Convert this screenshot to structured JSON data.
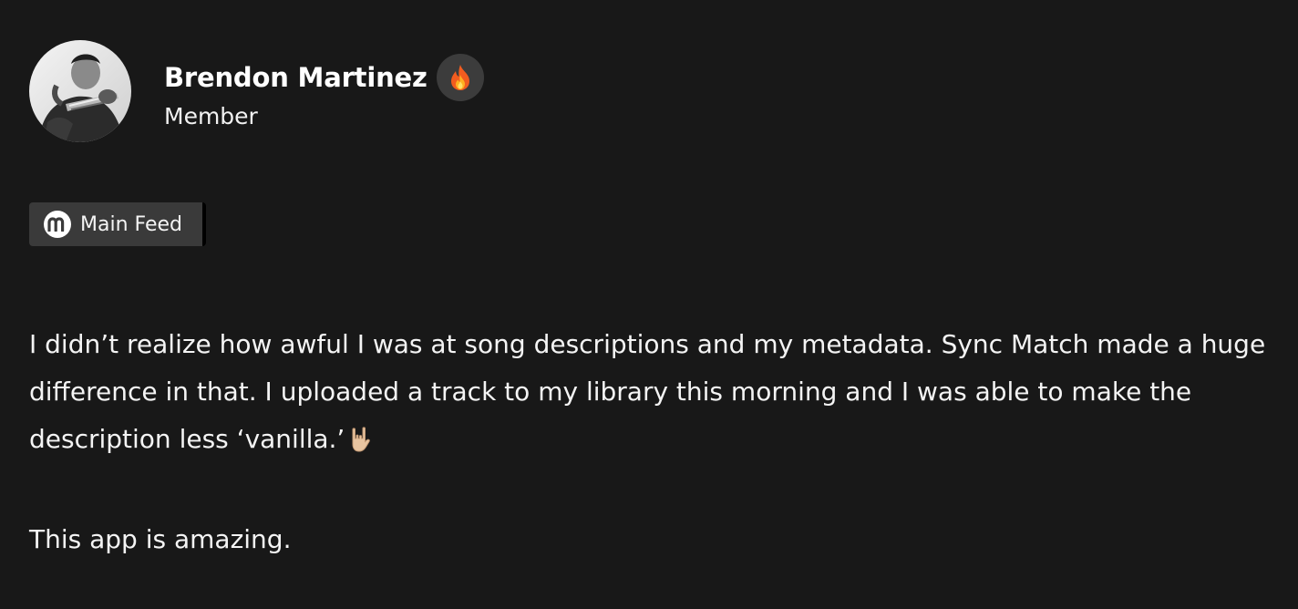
{
  "author": {
    "name": "Brendon Martinez",
    "role": "Member",
    "badge_icon": "fire-icon",
    "avatar_icon": "avatar-photo"
  },
  "feed": {
    "label": "Main Feed",
    "icon": "m-logo-icon"
  },
  "post": {
    "paragraph_1": "I didn’t realize how awful I was at song descriptions and my metadata. Sync Match made a huge difference in that. I uploaded a track to my library this morning and I was able to make the description less ‘vanilla.’",
    "paragraph_1_emoji": "rock-on-hand-icon",
    "paragraph_2": "This app is amazing."
  },
  "colors": {
    "background": "#181818",
    "chip_background": "#3a3a3a",
    "badge_background": "#3c3c3c",
    "text": "#ffffff"
  }
}
